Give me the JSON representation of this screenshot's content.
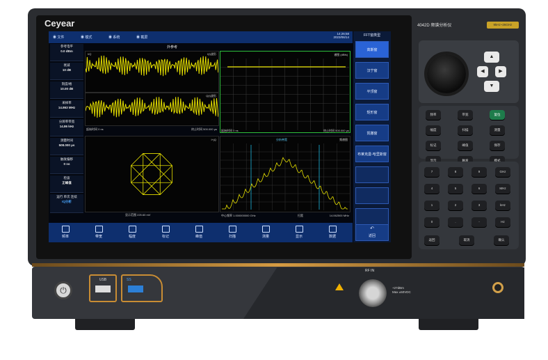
{
  "brand": "Ceyear",
  "model": "4042D 频谱分析仪",
  "model_badge": "9kHz~26GHz",
  "menu": [
    "文件",
    "模式",
    "系统",
    "截屏"
  ],
  "clock": {
    "time": "14:26:58",
    "date": "2023/06/14"
  },
  "panel_title": "外参考",
  "fft_title": "FFT窗类型",
  "softkeys": [
    "高斯窗",
    "汉宁窗",
    "平顶窗",
    "矩形窗",
    "凯撒窗",
    "布莱克曼-哈里斯窗"
  ],
  "back_label": "返回",
  "params": [
    {
      "label": "参考电平",
      "value": "0.0 dBm"
    },
    {
      "label": "衰减",
      "value": "10 dB"
    },
    {
      "label": "刻度/格",
      "value": "10.00 dB"
    },
    {
      "label": "采样率",
      "value": "14.863 MHz"
    },
    {
      "label": "分辨率带宽",
      "value": "14.86 kHz"
    },
    {
      "label": "测量时间",
      "value": "508.000 μs"
    },
    {
      "label": "触发偏移",
      "value": "0 ns"
    },
    {
      "label": "检波",
      "value": "正峰值"
    }
  ],
  "status": [
    "运行",
    "单次",
    "连续"
  ],
  "iq_label": "IQ分析",
  "toolbar": [
    "频率",
    "带宽",
    "幅度",
    "标记",
    "峰值",
    "扫描",
    "测量",
    "显示",
    "数据"
  ],
  "panels": {
    "i_trace": {
      "tl": "I/Q",
      "tr": "I(t)波形"
    },
    "q_trace": {
      "tr": "Q(t)波形"
    },
    "spectrum_top": {
      "tr": "谱图 (dBfs)"
    },
    "time_foot_left": "起始时间",
    "time_foot_left_val": "0 ns",
    "time_foot_right": "终止时间",
    "time_foot_right_val": "500.000 μs",
    "constellation": {
      "tr": "I+jQ"
    },
    "constellation_foot": "显示范围 225.60 mV",
    "spectrum_bottom": {
      "tc": "分析带宽",
      "tr": "频谱图"
    },
    "center_freq_label": "中心频率",
    "center_freq": "1.000000000 GHz",
    "span_label": "扫宽",
    "span": "14.062500 MHz"
  },
  "keys_function": [
    "频率",
    "带宽",
    "复位",
    "幅度",
    "扫描",
    "测量",
    "标记",
    "峰值",
    "保存",
    "显示",
    "触发",
    "模式"
  ],
  "keys_numeric": [
    "7",
    "8",
    "9",
    "GHz",
    "4",
    "5",
    "6",
    "MHz",
    "1",
    "2",
    "3",
    "kHz",
    "0",
    ".",
    "-",
    "Hz"
  ],
  "keys_bottom": [
    "返回",
    "取消",
    "确认"
  ],
  "rf_label": "RF IN",
  "rf_spec": [
    "+27dBm",
    "Max ±50VDC"
  ],
  "usb_labels": [
    "USB",
    "SS"
  ],
  "colors": {
    "trace": "#e8e200",
    "accent": "#c98d34",
    "softkey": "#163c86"
  }
}
